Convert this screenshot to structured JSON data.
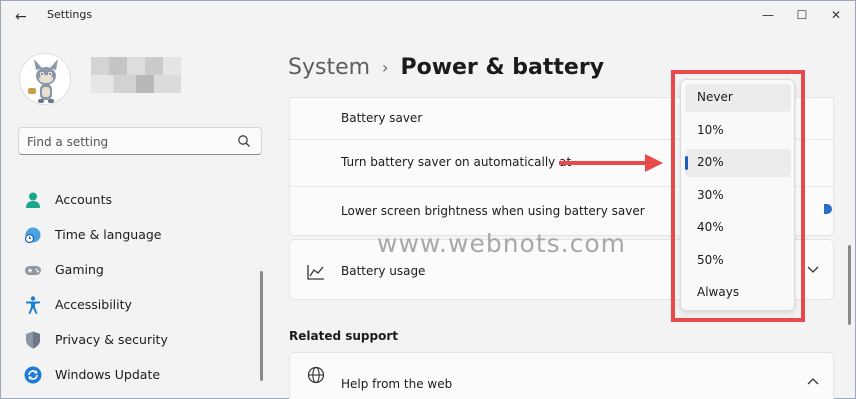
{
  "window": {
    "title": "Settings",
    "back_glyph": "←",
    "minimize_glyph": "—",
    "maximize_glyph": "☐",
    "close_glyph": "✕"
  },
  "sidebar": {
    "search_placeholder": "Find a setting",
    "items": [
      {
        "label": "Accounts",
        "icon": "accounts-icon"
      },
      {
        "label": "Time & language",
        "icon": "globe-clock-icon"
      },
      {
        "label": "Gaming",
        "icon": "gamepad-icon"
      },
      {
        "label": "Accessibility",
        "icon": "accessibility-icon"
      },
      {
        "label": "Privacy & security",
        "icon": "shield-icon"
      },
      {
        "label": "Windows Update",
        "icon": "update-icon"
      }
    ]
  },
  "breadcrumb": {
    "parent": "System",
    "separator": "›",
    "current": "Power & battery"
  },
  "battery_card": {
    "rows": [
      {
        "label": "Battery saver"
      },
      {
        "label": "Turn battery saver on automatically at"
      },
      {
        "label": "Lower screen brightness when using battery saver"
      }
    ]
  },
  "battery_usage": {
    "label": "Battery usage"
  },
  "related_support": {
    "header": "Related support",
    "help_label": "Help from the web"
  },
  "dropdown": {
    "options": [
      "Never",
      "10%",
      "20%",
      "30%",
      "40%",
      "50%",
      "Always"
    ],
    "selected": "20%",
    "hovered": "Never"
  },
  "watermark": "www.webnots.com",
  "colors": {
    "accent": "#1f5fb8",
    "annotation_red": "#e74a4a",
    "background": "#f3f3f3"
  }
}
